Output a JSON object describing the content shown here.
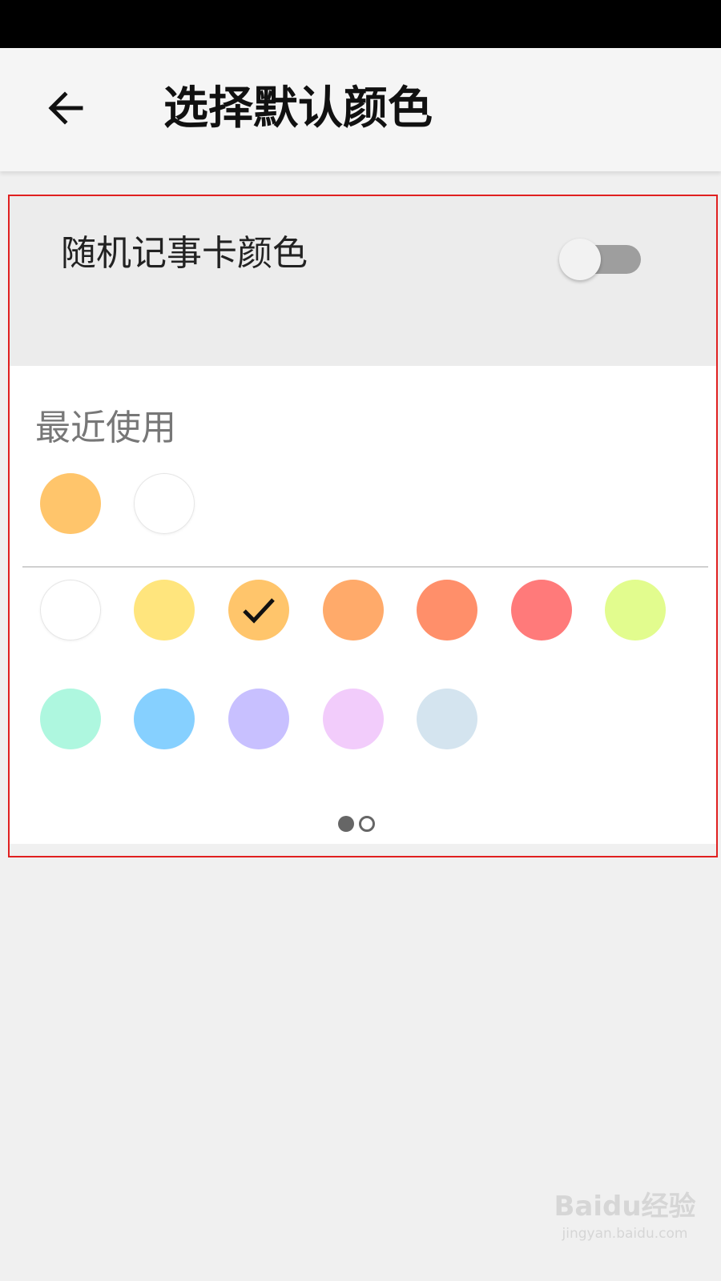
{
  "header": {
    "title": "选择默认颜色",
    "back_icon": "arrow-left-icon"
  },
  "random_color": {
    "label": "随机记事卡颜色",
    "enabled": false
  },
  "recent": {
    "label": "最近使用",
    "colors": [
      "#FFC56B",
      "#FFFFFF"
    ]
  },
  "palette": {
    "colors": [
      "#FFFFFF",
      "#FFE57D",
      "#FFC56B",
      "#FFAA6A",
      "#FF8F6A",
      "#FF7A7A",
      "#E2FC8E",
      "#AEF7DF",
      "#86D0FF",
      "#C8C0FF",
      "#F2CCFB",
      "#D4E4EF"
    ],
    "selected_index": 2,
    "check_icon": "checkmark-icon"
  },
  "pager": {
    "pages": 2,
    "current": 1
  },
  "watermark": {
    "logo": "Baidu经验",
    "url": "jingyan.baidu.com"
  }
}
